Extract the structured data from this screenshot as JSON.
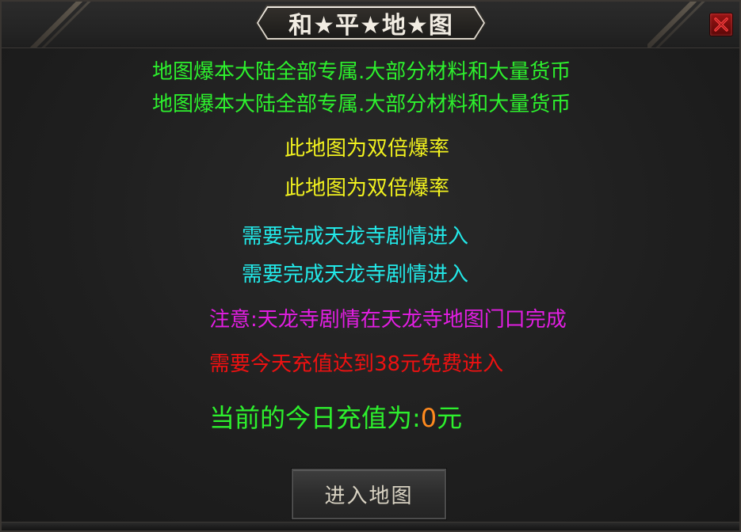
{
  "dialog": {
    "title": "和★平★地★图",
    "close_icon": "close-icon",
    "close_color": "#9a1414"
  },
  "lines": {
    "green_1": "地图爆本大陆全部专属.大部分材料和大量货币",
    "green_2": "地图爆本大陆全部专属.大部分材料和大量货币",
    "yellow_1": "此地图为双倍爆率",
    "yellow_2": "此地图为双倍爆率",
    "cyan_1": "需要完成天龙寺剧情进入",
    "cyan_2": "需要完成天龙寺剧情进入",
    "magenta_1": "注意:天龙寺剧情在天龙寺地图门口完成",
    "red_1": "需要今天充值达到38元免费进入"
  },
  "recharge": {
    "label": "当前的今日充值为:",
    "amount": "0",
    "unit": "元"
  },
  "buttons": {
    "enter_map": "进入地图"
  },
  "colors": {
    "green": "#2df02d",
    "yellow": "#f2f21e",
    "cyan": "#22e8e8",
    "magenta": "#e21ee2",
    "red": "#ee1111",
    "orange": "#ff8a1e"
  }
}
